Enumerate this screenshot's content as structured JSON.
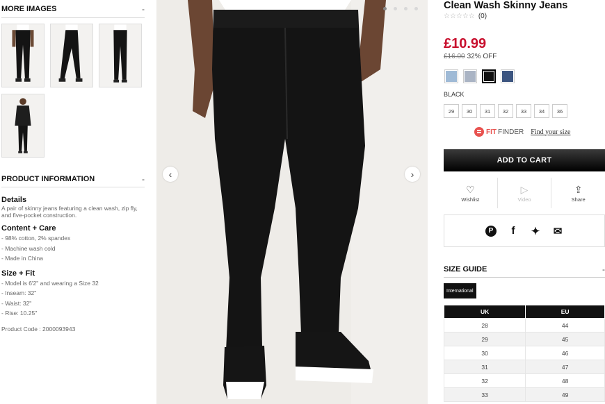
{
  "more_images": {
    "title": "MORE IMAGES",
    "toggle": "-"
  },
  "product_info": {
    "title": "PRODUCT INFORMATION",
    "toggle": "-",
    "details_heading": "Details",
    "details_text": "A pair of skinny jeans featuring a clean wash, zip fly, and five-pocket construction.",
    "content_heading": "Content + Care",
    "content_items": [
      "- 98% cotton, 2% spandex",
      "- Machine wash cold",
      "- Made in China"
    ],
    "size_heading": "Size + Fit",
    "size_items": [
      "- Model is 6'2\" and wearing a Size 32",
      "- Inseam: 32\"",
      "- Waist: 32\"",
      "- Rise: 10.25\""
    ],
    "product_code": "Product Code : 2000093943"
  },
  "product": {
    "title": "Clean Wash Skinny Jeans",
    "stars": "☆☆☆☆☆",
    "review_count": "(0)",
    "price": "£10.99",
    "was_price": "£16.00",
    "discount": "32% OFF",
    "swatch_colors": [
      "#9fbad6",
      "#aab4c4",
      "#111111",
      "#3c5580"
    ],
    "selected_swatch": 2,
    "color_name": "BLACK",
    "sizes": [
      "29",
      "30",
      "31",
      "32",
      "33",
      "34",
      "36"
    ],
    "fit_bold": "FIT",
    "fit_rest": "FINDER",
    "fit_link": "Find your size",
    "add_to_cart": "ADD TO CART",
    "wishlist": "Wishlist",
    "video": "Video",
    "share": "Share"
  },
  "size_guide": {
    "title": "SIZE GUIDE",
    "toggle": "-",
    "tab": "International",
    "headers": [
      "UK",
      "EU"
    ],
    "rows": [
      [
        "28",
        "44"
      ],
      [
        "29",
        "45"
      ],
      [
        "30",
        "46"
      ],
      [
        "31",
        "47"
      ],
      [
        "32",
        "48"
      ],
      [
        "33",
        "49"
      ]
    ]
  },
  "carousel": {
    "active_index": 0,
    "count": 4,
    "prev": "‹",
    "next": "›"
  },
  "colors": {
    "price_red": "#c8102e",
    "fit_red": "#e8524f"
  }
}
